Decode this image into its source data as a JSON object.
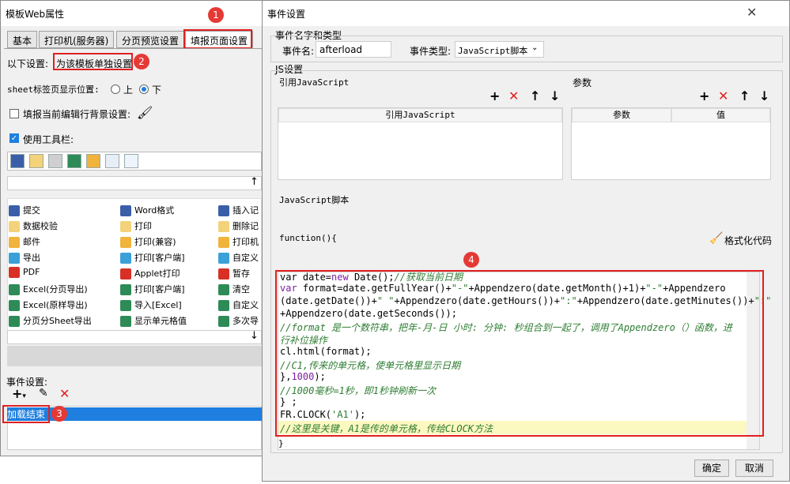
{
  "left_window": {
    "title": "模板Web属性",
    "tabs": [
      "基本",
      "打印机(服务器)",
      "分页预览设置",
      "填报页面设置"
    ],
    "settings_label": "以下设置:",
    "settings_value": "为该模板单独设置",
    "sheet_position_label": "sheet标签页显示位置:",
    "radio_top": "上",
    "radio_bottom": "下",
    "fill_bg_label": "填报当前编辑行背景设置:",
    "use_toolbar_label": "使用工具栏:",
    "buttons_col1": [
      "提交",
      "数据校验",
      "邮件",
      "导出",
      "PDF",
      "Excel(分页导出)",
      "Excel(原样导出)",
      "分页分Sheet导出"
    ],
    "buttons_col2": [
      "Word格式",
      "打印",
      "打印(兼容)",
      "打印[客户端]",
      "Applet打印",
      "打印[客户端]",
      "导入[Excel]",
      "显示单元格值"
    ],
    "buttons_col3": [
      "插入记",
      "删除记",
      "打印机",
      "自定义",
      "暂存",
      "清空",
      "自定义",
      "多次导"
    ],
    "event_settings_label": "事件设置:",
    "event_item": "加载结束"
  },
  "right_window": {
    "title": "事件设置",
    "group_name_type": "事件名字和类型",
    "event_name_label": "事件名:",
    "event_name_value": "afterload",
    "event_type_label": "事件类型:",
    "event_type_value": "JavaScript脚本",
    "js_settings_label": "JS设置",
    "ref_js_label": "引用JavaScript",
    "params_label": "参数",
    "ref_js_header": "引用JavaScript",
    "param_header": "参数",
    "value_header": "值",
    "js_script_label": "JavaScript脚本",
    "function_head": "function(){",
    "format_code_label": "格式化代码",
    "closing_brace": "}",
    "ok": "确定",
    "cancel": "取消"
  },
  "code": {
    "line1_pre": "        var date=",
    "line1_kw": "new",
    "line1_post": " Date();",
    "line1_cm": "//获取当前日期",
    "line2_kw": "        var",
    "line2_a": " format=date.getFullYear()+",
    "line2_s1": "\"-\"",
    "line2_b": "+Appendzero(date.getMonth()+1)+",
    "line2_s2": "\"-\"",
    "line2_c": "+Appendzero",
    "line3_a": "(date.getDate())+",
    "line3_s1": "\" \"",
    "line3_b": "+Appendzero(date.getHours())+",
    "line3_s2": "\":\"",
    "line3_c": "+Appendzero(date.getMinutes())+",
    "line3_s3": "\":\"",
    "line4": "+Appendzero(date.getSeconds());",
    "line5_cm": "//format 是一个数符串，把年-月-日 小时: 分钟: 秒组合到一起了，调用了Appendzero（）函数，进",
    "line6_cm": "行补位操作",
    "line7": "            cl.html(format);",
    "line8_cm": "//C1,传来的单元格，使单元格里显示日期",
    "line9_a": "    },",
    "line9_num": "1000",
    "line9_b": ");",
    "line10_cm": "//1000毫秒=1秒，即1秒钟刷新一次",
    "line11": "} ;",
    "line12_a": "FR.CLOCK(",
    "line12_s": "'A1'",
    "line12_b": ");",
    "line13_cm": "//这里是关键，A1是传的单元格，传给CLOCK方法"
  },
  "badges": [
    "1",
    "2",
    "3",
    "4"
  ],
  "colors": {
    "highlight_red": "#e02020",
    "badge_red": "#e53935",
    "selection_blue": "#1e7fe0",
    "line_highlight": "#fbf8c0"
  }
}
